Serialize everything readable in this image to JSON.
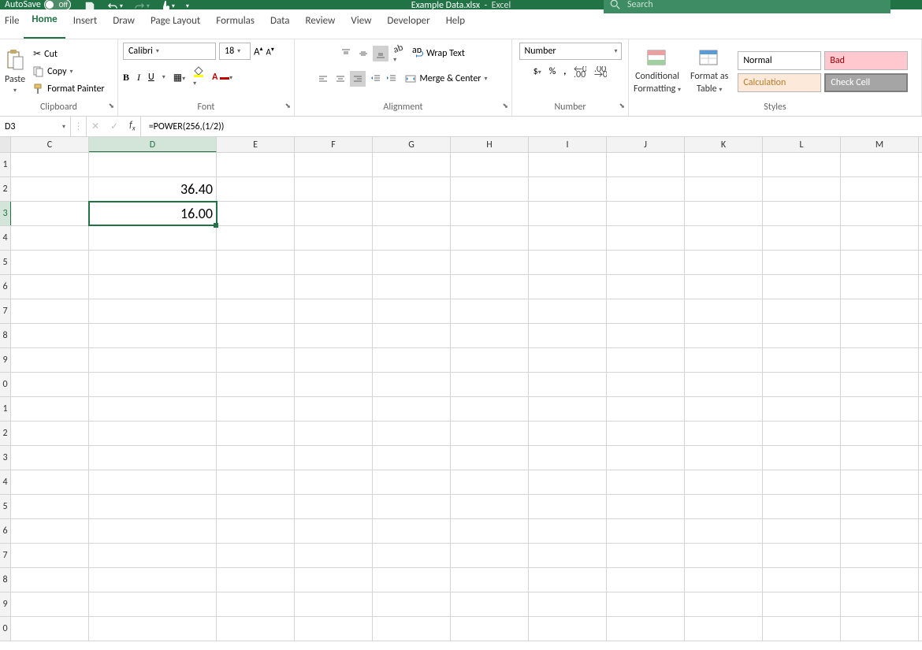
{
  "title": {
    "file": "Example Data.xlsx",
    "sep": "-",
    "app": "Excel"
  },
  "autosave_label": "AutoSave",
  "autosave_state": "Off",
  "search_placeholder": "Search",
  "tabs": [
    "File",
    "Home",
    "Insert",
    "Draw",
    "Page Layout",
    "Formulas",
    "Data",
    "Review",
    "View",
    "Developer",
    "Help"
  ],
  "active_tab": "Home",
  "clipboard": {
    "cut": "Cut",
    "copy": "Copy",
    "painter": "Format Painter",
    "paste": "Paste",
    "group": "Clipboard"
  },
  "font": {
    "name": "Calibri",
    "size": "18",
    "group": "Font"
  },
  "alignment": {
    "wrap": "Wrap Text",
    "merge": "Merge & Center",
    "group": "Alignment"
  },
  "number": {
    "format": "Number",
    "group": "Number"
  },
  "cond": {
    "label1": "Conditional",
    "label2": "Formatting"
  },
  "fat": {
    "label1": "Format as",
    "label2": "Table"
  },
  "styles": {
    "normal": "Normal",
    "bad": "Bad",
    "calculation": "Calculation",
    "check": "Check Cell",
    "group": "Styles"
  },
  "namebox": "D3",
  "formula": "=POWER(256,(1/2))",
  "columns": [
    "C",
    "D",
    "E",
    "F",
    "G",
    "H",
    "I",
    "J",
    "K",
    "L",
    "M"
  ],
  "selected_col": "D",
  "row_labels": [
    "1",
    "2",
    "3",
    "4",
    "5",
    "6",
    "7",
    "8",
    "9",
    "0",
    "1",
    "2",
    "3",
    "4",
    "5",
    "6",
    "7",
    "8",
    "9",
    "0"
  ],
  "selected_row_index": 2,
  "cells": {
    "D2": "36.40",
    "D3": "16.00"
  }
}
